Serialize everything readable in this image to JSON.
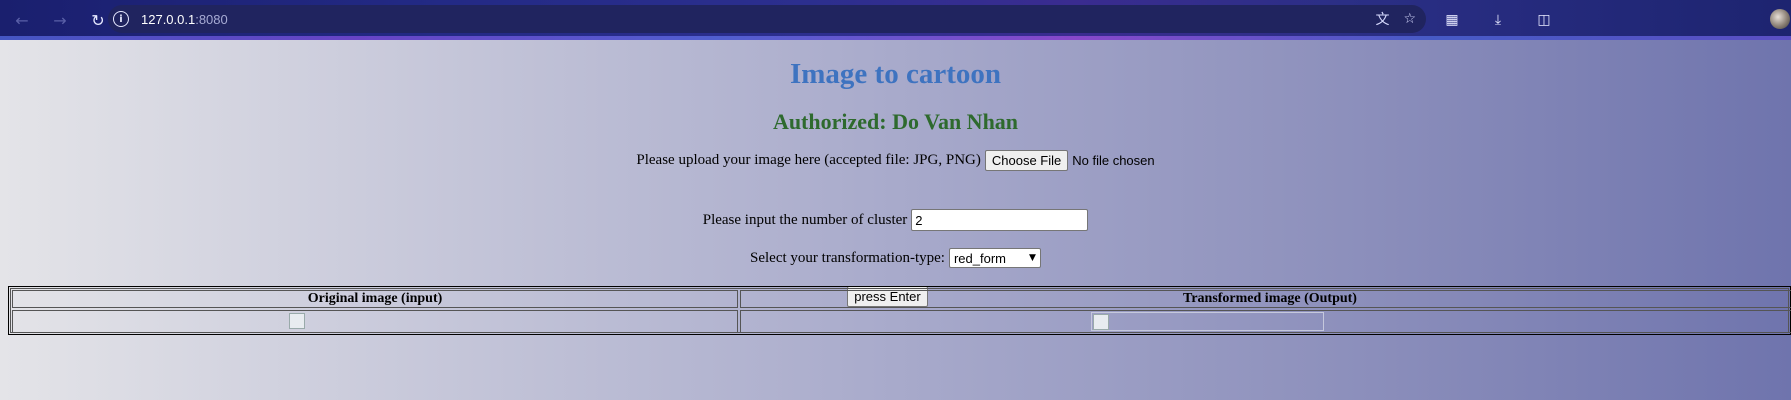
{
  "browser": {
    "url_host": "127.0.0.1",
    "url_port": ":8080",
    "icons": {
      "back": "back-arrow-icon",
      "forward": "forward-arrow-icon",
      "reload": "reload-icon",
      "site_info": "info-icon",
      "translate": "translate-icon",
      "bookmark": "star-icon",
      "extensions": "puzzle-icon",
      "downloads": "download-icon",
      "side_panel": "side-panel-icon"
    }
  },
  "page": {
    "title": "Image to cartoon",
    "author": "Authorized: Do Van Nhan",
    "upload_label": "Please upload your image here (accepted file: JPG, PNG)",
    "choose_file_label": "Choose File",
    "file_status": "No file chosen",
    "cluster_label": "Please input the number of cluster",
    "cluster_value": "2",
    "transform_label": "Select your transformation-type:",
    "transform_selected": "red_form",
    "submit_label": "press Enter",
    "table": {
      "headers": [
        "Original image (input)",
        "Transformed image (Output)"
      ]
    }
  }
}
